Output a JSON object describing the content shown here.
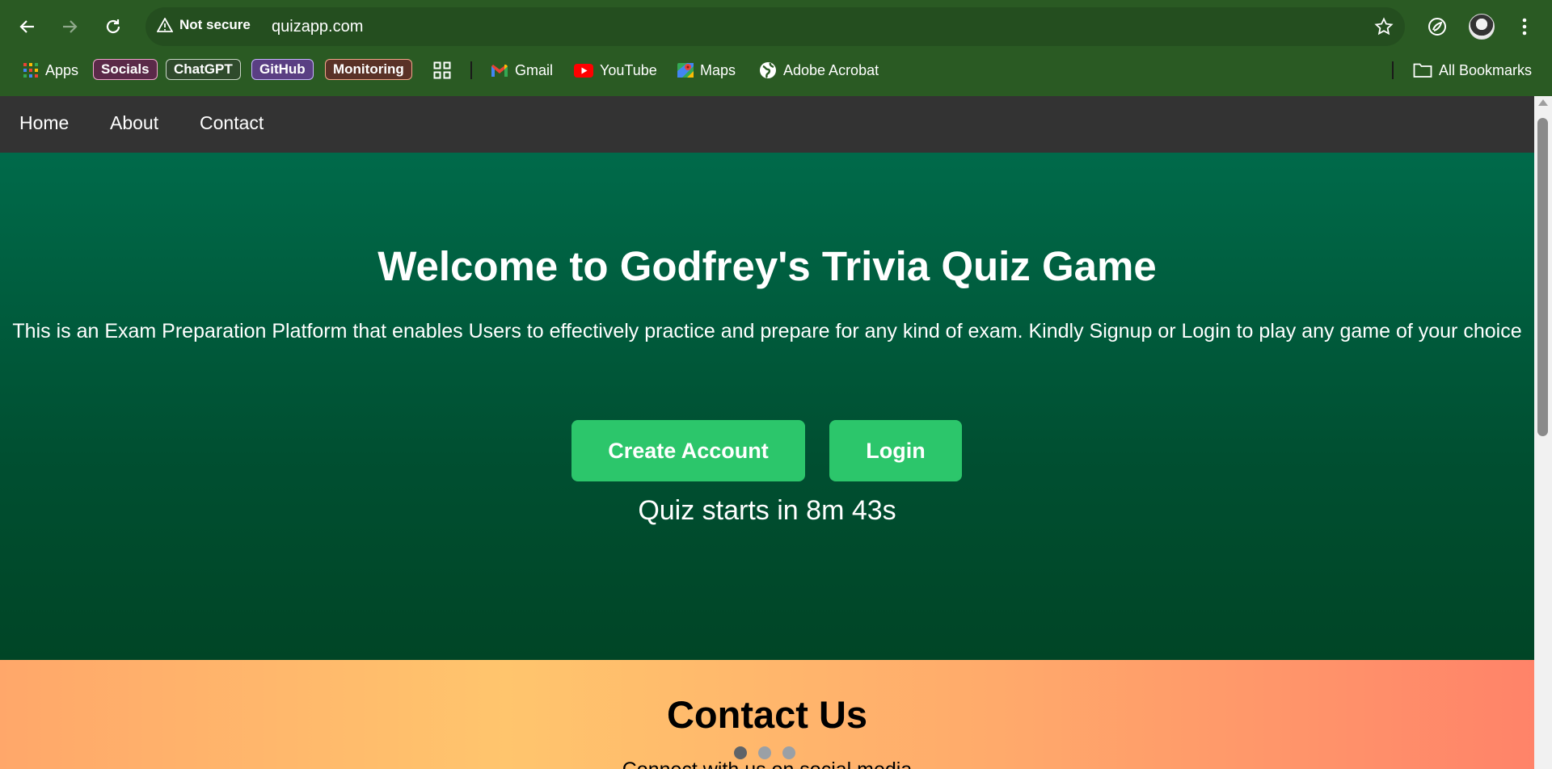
{
  "browser": {
    "security_label": "Not secure",
    "url": "quizapp.com",
    "bookmarks": {
      "apps_label": "Apps",
      "chips": [
        {
          "label": "Socials",
          "bg": "#5b2a49",
          "border": "#f3a4cf"
        },
        {
          "label": "ChatGPT",
          "bg": "#2f4a2c",
          "border": "#c9d6c7"
        },
        {
          "label": "GitHub",
          "bg": "#5a3f83",
          "border": "#c9b3ff"
        },
        {
          "label": "Monitoring",
          "bg": "#5a3227",
          "border": "#f5a68c"
        }
      ],
      "links": [
        {
          "label": "Gmail",
          "icon": "gmail-icon"
        },
        {
          "label": "YouTube",
          "icon": "youtube-icon"
        },
        {
          "label": "Maps",
          "icon": "maps-icon"
        },
        {
          "label": "Adobe Acrobat",
          "icon": "globe-icon"
        }
      ],
      "all_bookmarks_label": "All Bookmarks"
    }
  },
  "site": {
    "nav": [
      "Home",
      "About",
      "Contact"
    ],
    "hero": {
      "title": "Welcome to Godfrey's Trivia Quiz Game",
      "description": "This is an Exam Preparation Platform that enables Users to effectively practice and prepare for any kind of exam. Kindly Signup or Login to play any game of your choice",
      "create_account_label": "Create Account",
      "login_label": "Login",
      "countdown": "Quiz starts in 8m 43s"
    },
    "contact": {
      "title": "Contact Us",
      "subtitle": "Connect with us on social media"
    }
  },
  "colors": {
    "chrome_bg": "#2a5a23",
    "site_nav_bg": "#333333",
    "hero_green": "#005a3a",
    "button_green": "#2cc66b"
  }
}
